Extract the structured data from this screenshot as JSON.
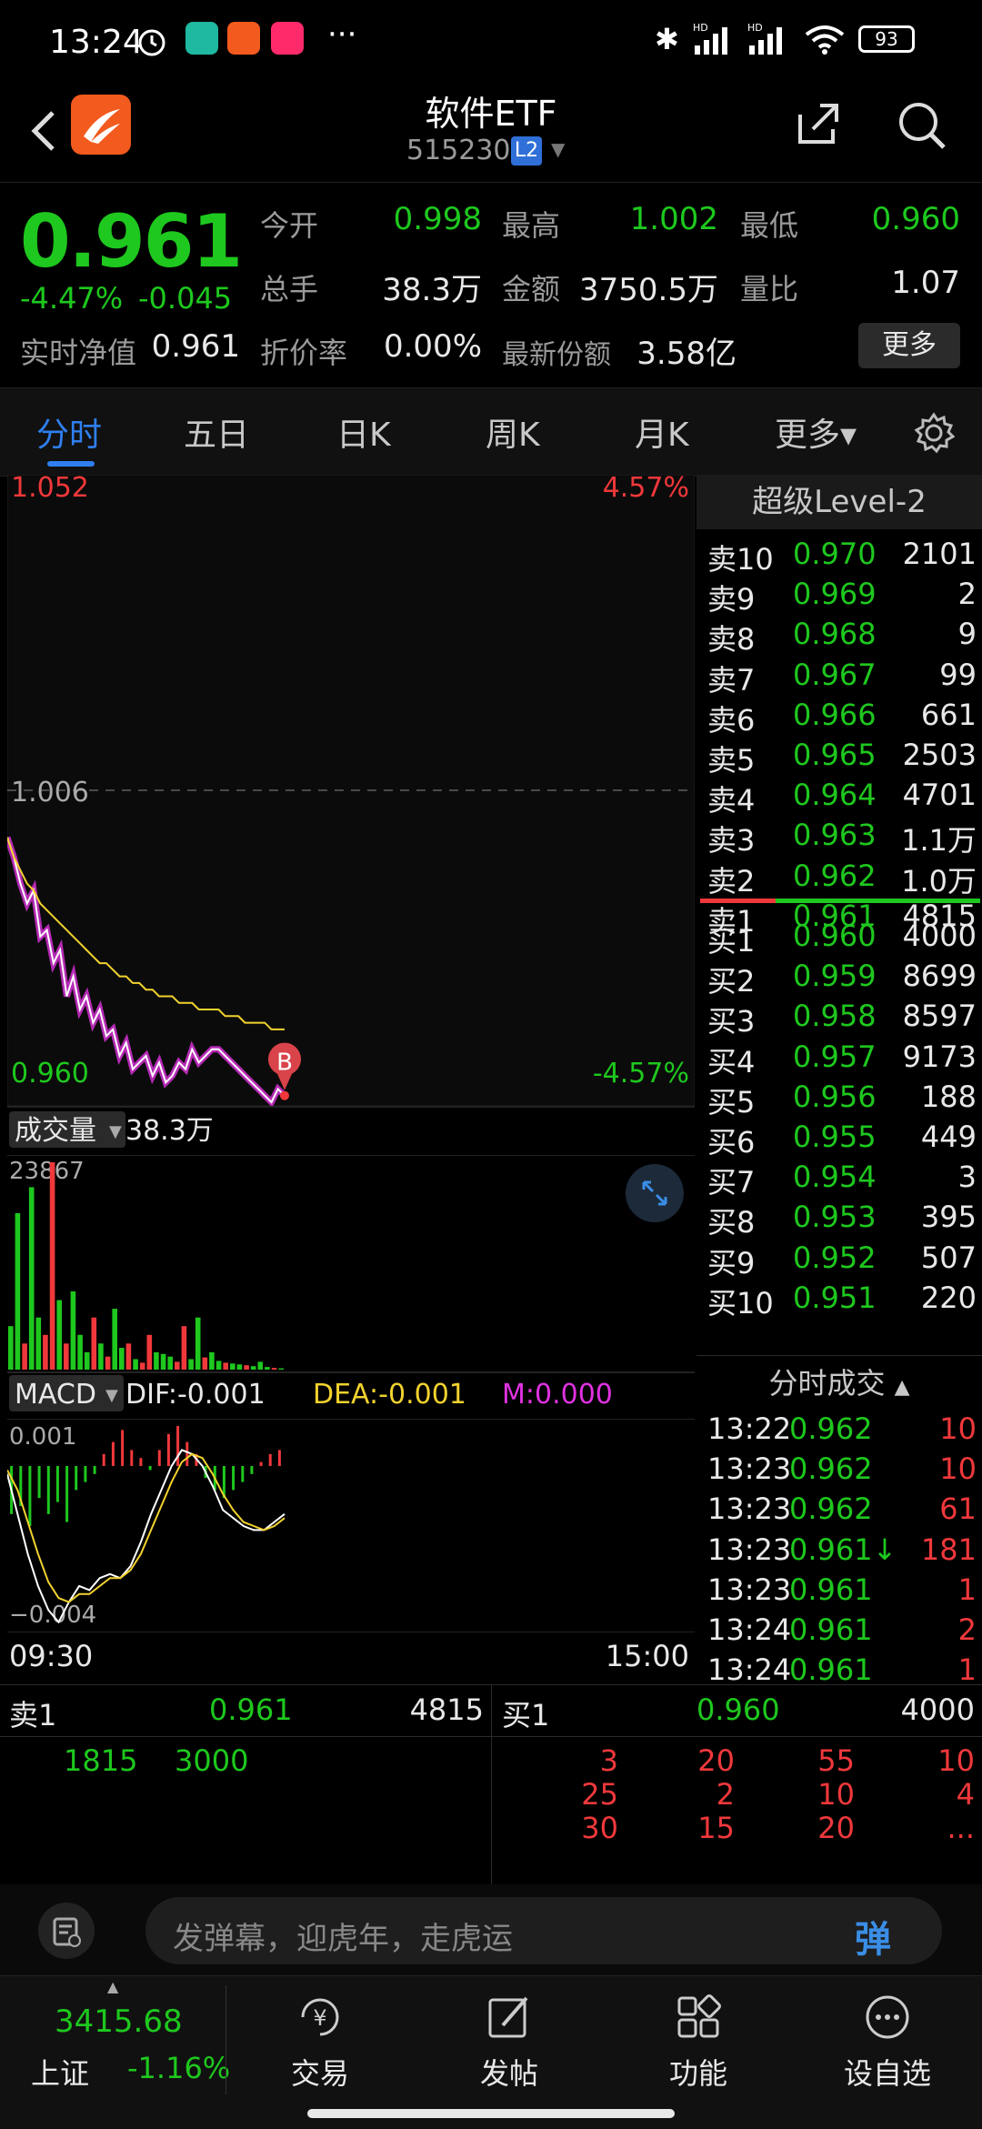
{
  "status_bar": {
    "time": "13:24",
    "battery": "93",
    "network": "HD"
  },
  "header": {
    "title": "软件ETF",
    "code": "515230",
    "level_badge": "L2"
  },
  "quote": {
    "price": "0.961",
    "change_pct": "-4.47%",
    "change_abs": "-0.045",
    "open_label": "今开",
    "open": "0.998",
    "high_label": "最高",
    "high": "1.002",
    "low_label": "最低",
    "low": "0.960",
    "volume_label": "总手",
    "volume": "38.3万",
    "amount_label": "金额",
    "amount": "3750.5万",
    "vol_ratio_label": "量比",
    "vol_ratio": "1.07",
    "nav_label": "实时净值",
    "nav": "0.961",
    "discount_label": "折价率",
    "discount": "0.00%",
    "shares_label": "最新份额",
    "shares": "3.58亿",
    "more_button": "更多"
  },
  "tabs": [
    {
      "label": "分时"
    },
    {
      "label": "五日"
    },
    {
      "label": "日K"
    },
    {
      "label": "周K"
    },
    {
      "label": "月K"
    },
    {
      "label": "更多▾"
    }
  ],
  "chart_data": [
    {
      "type": "line",
      "title": "",
      "y_top_label": "1.052",
      "y_mid_label": "1.006",
      "y_bottom_label": "0.960",
      "pct_top": "4.57%",
      "pct_bottom": "-4.57%",
      "ylim": [
        0.96,
        1.052
      ],
      "x_start": "09:30",
      "x_end": "15:00",
      "marker": "B",
      "series": [
        {
          "color": "#ffffff",
          "values": [
            1.0,
            0.997,
            0.993,
            0.99,
            0.992,
            0.985,
            0.986,
            0.981,
            0.983,
            0.976,
            0.979,
            0.974,
            0.976,
            0.972,
            0.974,
            0.97,
            0.971,
            0.967,
            0.969,
            0.965,
            0.966,
            0.967,
            0.964,
            0.966,
            0.963,
            0.964,
            0.966,
            0.965,
            0.968,
            0.966,
            0.967,
            0.968,
            0.968,
            0.967,
            0.966,
            0.965,
            0.964,
            0.963,
            0.962,
            0.961,
            0.96,
            0.962,
            0.961
          ]
        },
        {
          "color": "#f2d22e",
          "values": [
            1.0,
            0.997,
            0.995,
            0.993,
            0.992,
            0.99,
            0.989,
            0.988,
            0.987,
            0.986,
            0.985,
            0.984,
            0.983,
            0.982,
            0.981,
            0.981,
            0.98,
            0.979,
            0.979,
            0.978,
            0.978,
            0.977,
            0.977,
            0.976,
            0.976,
            0.976,
            0.975,
            0.975,
            0.975,
            0.974,
            0.974,
            0.974,
            0.974,
            0.973,
            0.973,
            0.973,
            0.972,
            0.972,
            0.972,
            0.972,
            0.971,
            0.971,
            0.971
          ]
        }
      ]
    },
    {
      "type": "bar",
      "title": "成交量",
      "label": "38.3万",
      "y_max_label": "23867",
      "values": [
        5000,
        18000,
        3000,
        21000,
        6000,
        4000,
        23867,
        8000,
        3000,
        9000,
        4000,
        2000,
        6000,
        3000,
        1500,
        7000,
        2500,
        3000,
        1200,
        800,
        4000,
        2000,
        1800,
        1500,
        900,
        5000,
        1200,
        6000,
        1400,
        2000,
        1000,
        800,
        700,
        600,
        500,
        400,
        900,
        300,
        200,
        150
      ],
      "colors": [
        "g",
        "g",
        "r",
        "g",
        "g",
        "r",
        "r",
        "g",
        "r",
        "g",
        "g",
        "g",
        "r",
        "g",
        "r",
        "g",
        "g",
        "r",
        "g",
        "r",
        "r",
        "g",
        "g",
        "g",
        "r",
        "r",
        "g",
        "g",
        "r",
        "g",
        "g",
        "r",
        "g",
        "g",
        "r",
        "g",
        "g",
        "g",
        "r",
        "g"
      ]
    },
    {
      "type": "bar",
      "title": "MACD",
      "dif_label": "DIF:-0.001",
      "dea_label": "DEA:-0.001",
      "m_label": "M:0.000",
      "y_top_label": "0.001",
      "y_bottom_label": "−0.004",
      "ylim": [
        -0.004,
        0.001
      ],
      "macd": [
        -0.0012,
        -0.001,
        -0.0015,
        -0.0008,
        -0.0012,
        -0.0009,
        -0.0014,
        -0.0006,
        -0.0004,
        -0.0002,
        0.0003,
        0.0006,
        0.0009,
        0.0004,
        0.0002,
        -0.0001,
        0.0004,
        0.0008,
        0.001,
        0.0006,
        0.0003,
        -0.0003,
        -0.0006,
        -0.0008,
        -0.0006,
        -0.0004,
        -0.0002,
        0.0001,
        0.0003,
        0.0004
      ],
      "dif": [
        -0.0002,
        -0.0012,
        -0.0022,
        -0.003,
        -0.0036,
        -0.0039,
        -0.0034,
        -0.003,
        -0.0031,
        -0.0028,
        -0.0027,
        -0.0028,
        -0.0025,
        -0.0019,
        -0.0012,
        -0.0006,
        0.0,
        0.0004,
        0.0003,
        0.0,
        -0.0005,
        -0.0011,
        -0.0013,
        -0.0015,
        -0.0016,
        -0.0016,
        -0.0014,
        -0.0012
      ],
      "dea": [
        -0.0001,
        -0.0006,
        -0.0014,
        -0.0022,
        -0.0029,
        -0.0033,
        -0.0034,
        -0.0032,
        -0.0032,
        -0.003,
        -0.0028,
        -0.0028,
        -0.0026,
        -0.0022,
        -0.0016,
        -0.001,
        -0.0004,
        0.0001,
        0.0003,
        0.0002,
        -0.0002,
        -0.0007,
        -0.0011,
        -0.0014,
        -0.0015,
        -0.0016,
        -0.0015,
        -0.0013
      ]
    }
  ],
  "level2": {
    "title": "超级Level-2",
    "asks": [
      {
        "label": "卖10",
        "price": "0.970",
        "vol": "2101"
      },
      {
        "label": "卖9",
        "price": "0.969",
        "vol": "2"
      },
      {
        "label": "卖8",
        "price": "0.968",
        "vol": "9"
      },
      {
        "label": "卖7",
        "price": "0.967",
        "vol": "99"
      },
      {
        "label": "卖6",
        "price": "0.966",
        "vol": "661"
      },
      {
        "label": "卖5",
        "price": "0.965",
        "vol": "2503"
      },
      {
        "label": "卖4",
        "price": "0.964",
        "vol": "4701"
      },
      {
        "label": "卖3",
        "price": "0.963",
        "vol": "1.1万"
      },
      {
        "label": "卖2",
        "price": "0.962",
        "vol": "1.0万"
      },
      {
        "label": "卖1",
        "price": "0.961",
        "vol": "4815"
      }
    ],
    "bids": [
      {
        "label": "买1",
        "price": "0.960",
        "vol": "4000"
      },
      {
        "label": "买2",
        "price": "0.959",
        "vol": "8699"
      },
      {
        "label": "买3",
        "price": "0.958",
        "vol": "8597"
      },
      {
        "label": "买4",
        "price": "0.957",
        "vol": "9173"
      },
      {
        "label": "买5",
        "price": "0.956",
        "vol": "188"
      },
      {
        "label": "买6",
        "price": "0.955",
        "vol": "449"
      },
      {
        "label": "买7",
        "price": "0.954",
        "vol": "3"
      },
      {
        "label": "买8",
        "price": "0.953",
        "vol": "395"
      },
      {
        "label": "买9",
        "price": "0.952",
        "vol": "507"
      },
      {
        "label": "买10",
        "price": "0.951",
        "vol": "220"
      }
    ],
    "ticks_title": "分时成交",
    "ticks": [
      {
        "time": "13:22",
        "price": "0.962",
        "vol": "10"
      },
      {
        "time": "13:23",
        "price": "0.962",
        "vol": "10"
      },
      {
        "time": "13:23",
        "price": "0.962",
        "vol": "61"
      },
      {
        "time": "13:23",
        "price": "0.961↓",
        "vol": "181"
      },
      {
        "time": "13:23",
        "price": "0.961",
        "vol": "1"
      },
      {
        "time": "13:24",
        "price": "0.961",
        "vol": "2"
      },
      {
        "time": "13:24",
        "price": "0.961",
        "vol": "1"
      }
    ]
  },
  "queue": {
    "sell_label": "卖1",
    "sell_price": "0.961",
    "sell_vol": "4815",
    "buy_label": "买1",
    "buy_price": "0.960",
    "buy_vol": "4000",
    "sell_orders": [
      "1815",
      "3000"
    ],
    "buy_orders": [
      "3",
      "20",
      "55",
      "10",
      "25",
      "2",
      "10",
      "4",
      "30",
      "15",
      "20",
      "..."
    ]
  },
  "danmu": {
    "placeholder": "发弹幕，迎虎年，走虎运",
    "send_label": "弹"
  },
  "bottom_nav": {
    "index_value": "3415.68",
    "index_name": "上证",
    "index_change": "-1.16%",
    "items": [
      {
        "label": "交易"
      },
      {
        "label": "发帖"
      },
      {
        "label": "功能"
      },
      {
        "label": "设自选"
      }
    ]
  }
}
